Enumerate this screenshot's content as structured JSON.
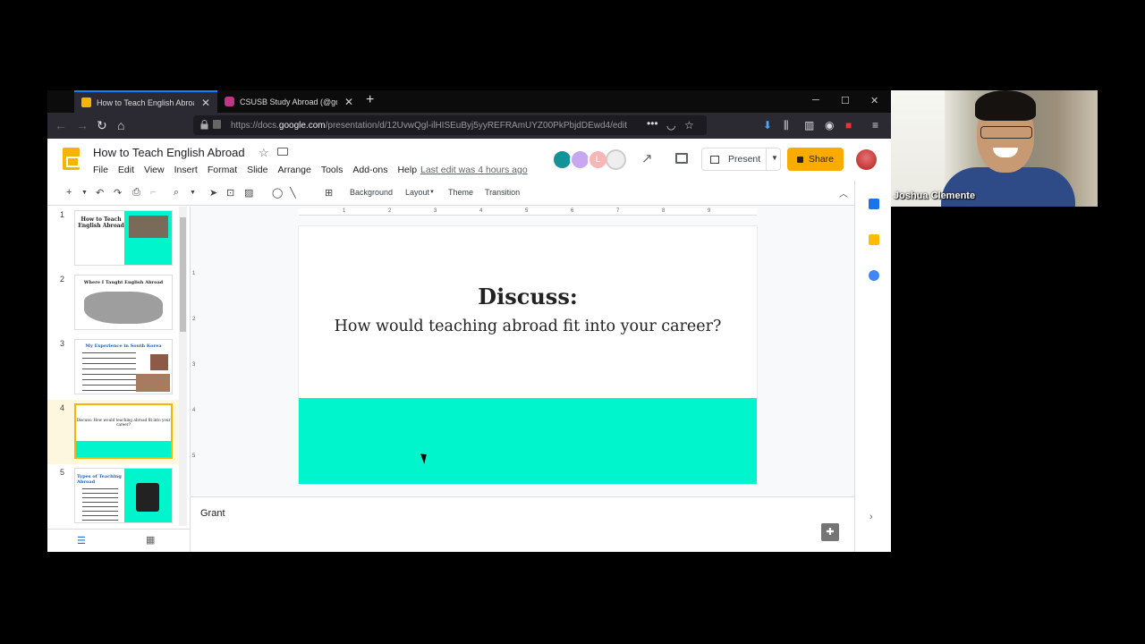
{
  "browser": {
    "tabs": [
      {
        "title": "How to Teach English Abroad",
        "favicon_color": "#f4b400"
      },
      {
        "title": "CSUSB Study Abroad (@goabroad)",
        "favicon_color": "#c13584"
      }
    ],
    "new_tab": "+",
    "url_prefix": "https://docs.",
    "url_domain": "google.com",
    "url_rest": "/presentation/d/12UvwQgl-ilHISEuByj5yyREFRAmUYZ00PkPbjdDEwd4/edit",
    "url_dots": "•••"
  },
  "slides_app": {
    "title": "How to Teach English Abroad",
    "menu": [
      "File",
      "Edit",
      "View",
      "Insert",
      "Format",
      "Slide",
      "Arrange",
      "Tools",
      "Add-ons",
      "Help"
    ],
    "last_edit": "Last edit was 4 hours ago",
    "avatar_colors": [
      "#12939a",
      "#c7a8f0",
      "#f6b6b6",
      "#e0e0e0"
    ],
    "avatar_letters": [
      "",
      "",
      "L",
      ""
    ],
    "present_label": "Present",
    "share_label": "Share",
    "accent": "#f9ab00"
  },
  "toolbar": {
    "background": "Background",
    "layout": "Layout",
    "theme": "Theme",
    "transition": "Transition"
  },
  "filmstrip": {
    "slides": [
      {
        "num": "1",
        "text": "How to Teach English Abroad"
      },
      {
        "num": "2",
        "text": "Where I Taught English Abroad"
      },
      {
        "num": "3",
        "text": "My Experience in South Korea"
      },
      {
        "num": "4",
        "text": "Discuss: How would teaching abroad fit into your career?"
      },
      {
        "num": "5",
        "text": "Types of Teaching Abroad"
      }
    ],
    "active_index": 3
  },
  "ruler": {
    "top": [
      "1",
      "2",
      "3",
      "4",
      "5",
      "6",
      "7",
      "8",
      "9"
    ],
    "left": [
      "1",
      "2",
      "3",
      "4",
      "5"
    ]
  },
  "slide": {
    "title": "Discuss:",
    "subtitle": "How would teaching abroad fit into your career?",
    "band_color": "#00f5cd"
  },
  "notes": {
    "text": "Grant"
  },
  "webcam": {
    "name": "Joshua Clemente"
  }
}
